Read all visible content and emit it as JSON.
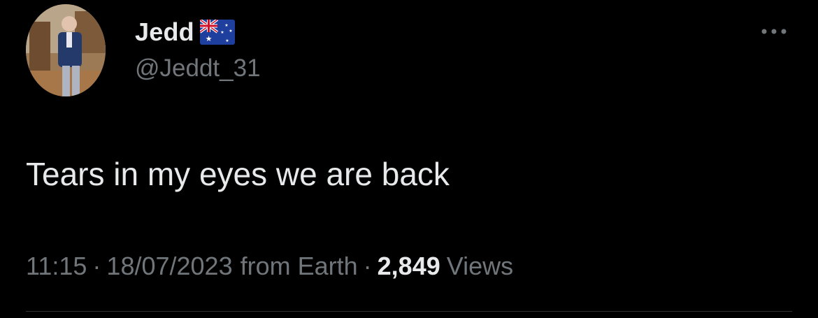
{
  "author": {
    "display_name": "Jedd",
    "flag_icon": "australia-flag-icon",
    "handle": "@Jeddt_31"
  },
  "tweet": {
    "text": "Tears in my eyes we are back"
  },
  "meta": {
    "time": "11:15",
    "separator": "·",
    "date": "18/07/2023",
    "source": "from Earth",
    "views_count": "2,849",
    "views_label": "Views"
  },
  "menu": {
    "more_icon": "more-horizontal-icon"
  },
  "colors": {
    "background": "#000000",
    "primary_text": "#e7e9ea",
    "secondary_text": "#71767b",
    "divider": "#2f3336"
  }
}
